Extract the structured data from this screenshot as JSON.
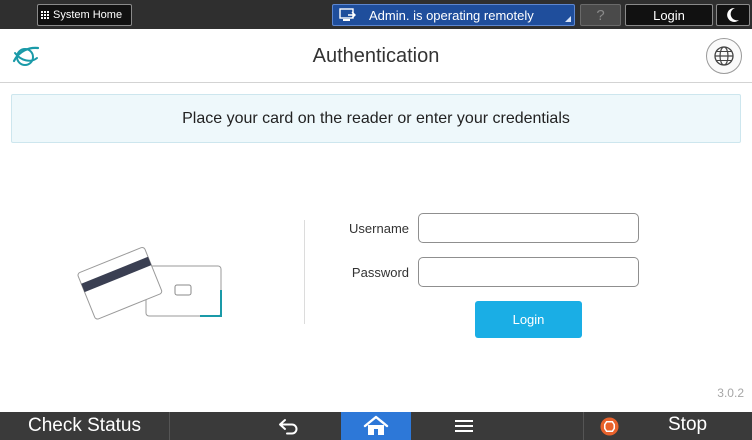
{
  "topbar": {
    "system_home_label": "System Home",
    "remote_banner_label": "Admin. is operating remotely",
    "help_label": "?",
    "login_label": "Login"
  },
  "header": {
    "title": "Authentication"
  },
  "main": {
    "instruction": "Place your card on the reader or enter your credentials",
    "username_label": "Username",
    "username_value": "",
    "password_label": "Password",
    "password_value": "",
    "login_button": "Login",
    "version": "3.0.2"
  },
  "bottombar": {
    "check_status_label": "Check Status",
    "stop_label": "Stop"
  },
  "icons": {
    "logo": "swirl-logo-icon",
    "globe": "globe-icon",
    "night": "moon-icon",
    "back": "back-arrow-icon",
    "home": "home-icon",
    "menu": "menu-icon",
    "stop": "stop-icon",
    "card": "card-reader-illustration"
  },
  "colors": {
    "topbar_bg": "#2f2f2f",
    "remote_banner_bg": "#1f4e9c",
    "accent_login": "#1aaee5",
    "home_active": "#2d78d8",
    "instruction_bg": "#eef8fb",
    "logo_teal": "#1a9aa8",
    "stop_orange": "#e8622c"
  }
}
